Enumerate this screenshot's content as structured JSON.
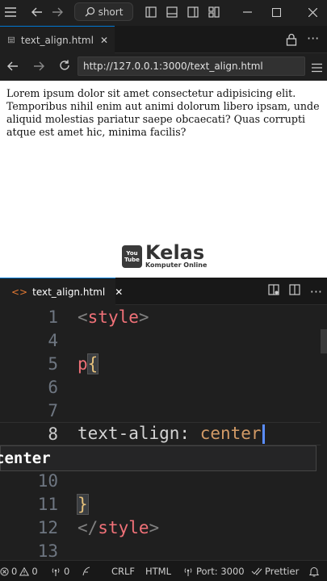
{
  "titlebar": {
    "search_label": "short"
  },
  "preview": {
    "tab_label": "text_align.html",
    "url": "http://127.0.0.1:3000/text_align.html",
    "paragraph": "Lorem ipsum dolor sit amet consectetur adipisicing elit. Temporibus nihil enim aut animi dolorum libero ipsam, unde aliquid molestias pariatur saepe obcaecati? Quas corrupti atque est amet hic, minima facilis?"
  },
  "logo": {
    "badge_top": "You",
    "badge_bottom": "Tube",
    "title": "Kelas",
    "subtitle": "Komputer Online"
  },
  "editor": {
    "tab_label": "text_align.html",
    "lines": [
      {
        "num": "1",
        "text": "<style>"
      },
      {
        "num": "4",
        "text": ""
      },
      {
        "num": "5",
        "text": "p{"
      },
      {
        "num": "6",
        "text": ""
      },
      {
        "num": "7",
        "text": ""
      },
      {
        "num": "8",
        "text": "text-align: center"
      },
      {
        "num": "10",
        "text": ""
      },
      {
        "num": "11",
        "text": "}"
      },
      {
        "num": "12",
        "text": "</style>"
      },
      {
        "num": "13",
        "text": ""
      }
    ],
    "suggestion": "center"
  },
  "statusbar": {
    "errors": "0",
    "warnings": "0",
    "ports": "0",
    "eol": "CRLF",
    "language": "HTML",
    "port": "Port: 3000",
    "formatter": "Prettier"
  },
  "colors": {
    "accent": "#0078d4",
    "tag": "#f07178",
    "value": "#d19a66",
    "cursor": "#5a8dff"
  }
}
